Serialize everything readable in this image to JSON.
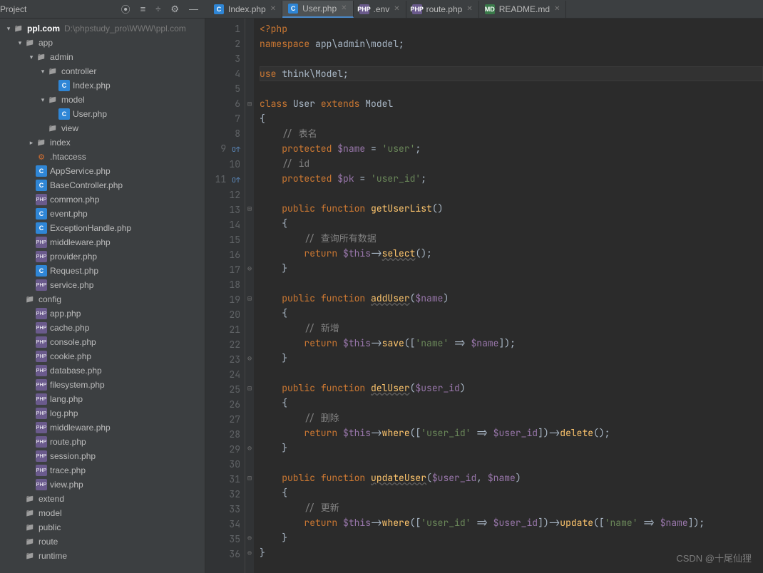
{
  "project_label": "Project",
  "toolbar_icons": [
    "target-icon",
    "collapse-icon",
    "refresh-icon",
    "gear-icon",
    "minimize-icon"
  ],
  "tabs": [
    {
      "icon": "ico-c",
      "label": "Index.php",
      "active": false
    },
    {
      "icon": "ico-c",
      "label": "User.php",
      "active": true
    },
    {
      "icon": "ico-php",
      "label": ".env",
      "active": false
    },
    {
      "icon": "ico-php",
      "label": "route.php",
      "active": false
    },
    {
      "icon": "ico-md",
      "label": "README.md",
      "active": false
    }
  ],
  "tree": [
    {
      "indent": 0,
      "chev": "▾",
      "icon": "folder",
      "label": "ppl.com",
      "bold": true,
      "path": "D:\\phpstudy_pro\\WWW\\ppl.com"
    },
    {
      "indent": 1,
      "chev": "▾",
      "icon": "folder",
      "label": "app"
    },
    {
      "indent": 2,
      "chev": "▾",
      "icon": "folder",
      "label": "admin"
    },
    {
      "indent": 3,
      "chev": "▾",
      "icon": "folder",
      "label": "controller"
    },
    {
      "indent": 4,
      "chev": "",
      "icon": "file-c",
      "label": "Index.php"
    },
    {
      "indent": 3,
      "chev": "▾",
      "icon": "folder",
      "label": "model"
    },
    {
      "indent": 4,
      "chev": "",
      "icon": "file-c",
      "label": "User.php"
    },
    {
      "indent": 3,
      "chev": "",
      "icon": "folder",
      "label": "view"
    },
    {
      "indent": 2,
      "chev": "▸",
      "icon": "folder",
      "label": "index"
    },
    {
      "indent": 2,
      "chev": "",
      "icon": "file-ht",
      "label": ".htaccess"
    },
    {
      "indent": 2,
      "chev": "",
      "icon": "file-c",
      "label": "AppService.php"
    },
    {
      "indent": 2,
      "chev": "",
      "icon": "file-c",
      "label": "BaseController.php"
    },
    {
      "indent": 2,
      "chev": "",
      "icon": "file-php",
      "label": "common.php"
    },
    {
      "indent": 2,
      "chev": "",
      "icon": "file-c",
      "label": "event.php"
    },
    {
      "indent": 2,
      "chev": "",
      "icon": "file-c",
      "label": "ExceptionHandle.php"
    },
    {
      "indent": 2,
      "chev": "",
      "icon": "file-php",
      "label": "middleware.php"
    },
    {
      "indent": 2,
      "chev": "",
      "icon": "file-php",
      "label": "provider.php"
    },
    {
      "indent": 2,
      "chev": "",
      "icon": "file-c",
      "label": "Request.php"
    },
    {
      "indent": 2,
      "chev": "",
      "icon": "file-php",
      "label": "service.php"
    },
    {
      "indent": 1,
      "chev": "",
      "icon": "folder",
      "label": "config"
    },
    {
      "indent": 2,
      "chev": "",
      "icon": "file-php",
      "label": "app.php"
    },
    {
      "indent": 2,
      "chev": "",
      "icon": "file-php",
      "label": "cache.php"
    },
    {
      "indent": 2,
      "chev": "",
      "icon": "file-php",
      "label": "console.php"
    },
    {
      "indent": 2,
      "chev": "",
      "icon": "file-php",
      "label": "cookie.php"
    },
    {
      "indent": 2,
      "chev": "",
      "icon": "file-php",
      "label": "database.php"
    },
    {
      "indent": 2,
      "chev": "",
      "icon": "file-php",
      "label": "filesystem.php"
    },
    {
      "indent": 2,
      "chev": "",
      "icon": "file-php",
      "label": "lang.php"
    },
    {
      "indent": 2,
      "chev": "",
      "icon": "file-php",
      "label": "log.php"
    },
    {
      "indent": 2,
      "chev": "",
      "icon": "file-php",
      "label": "middleware.php"
    },
    {
      "indent": 2,
      "chev": "",
      "icon": "file-php",
      "label": "route.php"
    },
    {
      "indent": 2,
      "chev": "",
      "icon": "file-php",
      "label": "session.php"
    },
    {
      "indent": 2,
      "chev": "",
      "icon": "file-php",
      "label": "trace.php"
    },
    {
      "indent": 2,
      "chev": "",
      "icon": "file-php",
      "label": "view.php"
    },
    {
      "indent": 1,
      "chev": "",
      "icon": "folder",
      "label": "extend"
    },
    {
      "indent": 1,
      "chev": "",
      "icon": "folder",
      "label": "model"
    },
    {
      "indent": 1,
      "chev": "",
      "icon": "folder",
      "label": "public"
    },
    {
      "indent": 1,
      "chev": "",
      "icon": "folder",
      "label": "route"
    },
    {
      "indent": 1,
      "chev": "",
      "icon": "folder",
      "label": "runtime"
    }
  ],
  "code": {
    "current_line": 4,
    "override_markers": [
      9,
      11
    ],
    "lines": [
      {
        "n": 1,
        "t": [
          [
            "kw",
            "<?php"
          ]
        ]
      },
      {
        "n": 2,
        "t": [
          [
            "kw",
            "namespace "
          ],
          [
            "cls",
            "app\\admin\\model"
          ],
          [
            "punct",
            ";"
          ]
        ]
      },
      {
        "n": 3,
        "t": []
      },
      {
        "n": 4,
        "hl": true,
        "t": [
          [
            "kw",
            "use "
          ],
          [
            "cls",
            "think\\Model"
          ],
          [
            "punct",
            ";"
          ]
        ]
      },
      {
        "n": 5,
        "t": []
      },
      {
        "n": 6,
        "fold": "⊟",
        "t": [
          [
            "kw",
            "class "
          ],
          [
            "cls",
            "User "
          ],
          [
            "kw",
            "extends "
          ],
          [
            "cls",
            "Model"
          ]
        ]
      },
      {
        "n": 7,
        "t": [
          [
            "punct",
            "{"
          ]
        ]
      },
      {
        "n": 8,
        "t": [
          [
            "",
            "    "
          ],
          [
            "cmt",
            "// 表名"
          ]
        ]
      },
      {
        "n": 9,
        "t": [
          [
            "",
            "    "
          ],
          [
            "kw",
            "protected "
          ],
          [
            "var",
            "$name"
          ],
          [
            "op",
            " = "
          ],
          [
            "str",
            "'user'"
          ],
          [
            "punct",
            ";"
          ]
        ]
      },
      {
        "n": 10,
        "t": [
          [
            "",
            "    "
          ],
          [
            "cmt",
            "// id"
          ]
        ]
      },
      {
        "n": 11,
        "t": [
          [
            "",
            "    "
          ],
          [
            "kw",
            "protected "
          ],
          [
            "var",
            "$pk"
          ],
          [
            "op",
            " = "
          ],
          [
            "str",
            "'user_id'"
          ],
          [
            "punct",
            ";"
          ]
        ]
      },
      {
        "n": 12,
        "t": []
      },
      {
        "n": 13,
        "fold": "⊟",
        "t": [
          [
            "",
            "    "
          ],
          [
            "kw",
            "public "
          ],
          [
            "kw",
            "function "
          ],
          [
            "fn",
            "getUserList"
          ],
          [
            "punct",
            "()"
          ]
        ]
      },
      {
        "n": 14,
        "t": [
          [
            "",
            "    "
          ],
          [
            "punct",
            "{"
          ]
        ]
      },
      {
        "n": 15,
        "t": [
          [
            "",
            "        "
          ],
          [
            "cmt",
            "// 查询所有数据"
          ]
        ]
      },
      {
        "n": 16,
        "t": [
          [
            "",
            "        "
          ],
          [
            "kw",
            "return "
          ],
          [
            "var",
            "$this"
          ],
          [
            "op",
            "->"
          ],
          [
            "fnu",
            "select"
          ],
          [
            "punct",
            "();"
          ]
        ]
      },
      {
        "n": 17,
        "fold": "⊖",
        "t": [
          [
            "",
            "    "
          ],
          [
            "punct",
            "}"
          ]
        ]
      },
      {
        "n": 18,
        "t": []
      },
      {
        "n": 19,
        "fold": "⊟",
        "t": [
          [
            "",
            "    "
          ],
          [
            "kw",
            "public "
          ],
          [
            "kw",
            "function "
          ],
          [
            "fnu",
            "addUser"
          ],
          [
            "punct",
            "("
          ],
          [
            "var",
            "$name"
          ],
          [
            "punct",
            ")"
          ]
        ]
      },
      {
        "n": 20,
        "t": [
          [
            "",
            "    "
          ],
          [
            "punct",
            "{"
          ]
        ]
      },
      {
        "n": 21,
        "t": [
          [
            "",
            "        "
          ],
          [
            "cmt",
            "// 新增"
          ]
        ]
      },
      {
        "n": 22,
        "t": [
          [
            "",
            "        "
          ],
          [
            "kw",
            "return "
          ],
          [
            "var",
            "$this"
          ],
          [
            "op",
            "->"
          ],
          [
            "fn",
            "save"
          ],
          [
            "punct",
            "(["
          ],
          [
            "str",
            "'name'"
          ],
          [
            "op",
            " => "
          ],
          [
            "var",
            "$name"
          ],
          [
            "punct",
            "]);"
          ]
        ]
      },
      {
        "n": 23,
        "fold": "⊖",
        "t": [
          [
            "",
            "    "
          ],
          [
            "punct",
            "}"
          ]
        ]
      },
      {
        "n": 24,
        "t": []
      },
      {
        "n": 25,
        "fold": "⊟",
        "t": [
          [
            "",
            "    "
          ],
          [
            "kw",
            "public "
          ],
          [
            "kw",
            "function "
          ],
          [
            "fnu",
            "delUser"
          ],
          [
            "punct",
            "("
          ],
          [
            "var",
            "$user_id"
          ],
          [
            "punct",
            ")"
          ]
        ]
      },
      {
        "n": 26,
        "t": [
          [
            "",
            "    "
          ],
          [
            "punct",
            "{"
          ]
        ]
      },
      {
        "n": 27,
        "t": [
          [
            "",
            "        "
          ],
          [
            "cmt",
            "// 删除"
          ]
        ]
      },
      {
        "n": 28,
        "t": [
          [
            "",
            "        "
          ],
          [
            "kw",
            "return "
          ],
          [
            "var",
            "$this"
          ],
          [
            "op",
            "->"
          ],
          [
            "fn",
            "where"
          ],
          [
            "punct",
            "(["
          ],
          [
            "str",
            "'user_id'"
          ],
          [
            "op",
            " => "
          ],
          [
            "var",
            "$user_id"
          ],
          [
            "punct",
            "])->"
          ],
          [
            "fn",
            "delete"
          ],
          [
            "punct",
            "();"
          ]
        ]
      },
      {
        "n": 29,
        "fold": "⊖",
        "t": [
          [
            "",
            "    "
          ],
          [
            "punct",
            "}"
          ]
        ]
      },
      {
        "n": 30,
        "t": []
      },
      {
        "n": 31,
        "fold": "⊟",
        "t": [
          [
            "",
            "    "
          ],
          [
            "kw",
            "public "
          ],
          [
            "kw",
            "function "
          ],
          [
            "fnu",
            "updateUser"
          ],
          [
            "punct",
            "("
          ],
          [
            "var",
            "$user_id"
          ],
          [
            "punct",
            ", "
          ],
          [
            "var",
            "$name"
          ],
          [
            "punct",
            ")"
          ]
        ]
      },
      {
        "n": 32,
        "t": [
          [
            "",
            "    "
          ],
          [
            "punct",
            "{"
          ]
        ]
      },
      {
        "n": 33,
        "t": [
          [
            "",
            "        "
          ],
          [
            "cmt",
            "// 更新"
          ]
        ]
      },
      {
        "n": 34,
        "t": [
          [
            "",
            "        "
          ],
          [
            "kw",
            "return "
          ],
          [
            "var",
            "$this"
          ],
          [
            "op",
            "->"
          ],
          [
            "fn",
            "where"
          ],
          [
            "punct",
            "(["
          ],
          [
            "str",
            "'user_id'"
          ],
          [
            "op",
            " => "
          ],
          [
            "var",
            "$user_id"
          ],
          [
            "punct",
            "])->"
          ],
          [
            "fn",
            "update"
          ],
          [
            "punct",
            "(["
          ],
          [
            "str",
            "'name'"
          ],
          [
            "op",
            " => "
          ],
          [
            "var",
            "$name"
          ],
          [
            "punct",
            "]);"
          ]
        ]
      },
      {
        "n": 35,
        "fold": "⊖",
        "t": [
          [
            "",
            "    "
          ],
          [
            "punct",
            "}"
          ]
        ]
      },
      {
        "n": 36,
        "fold": "⊖",
        "t": [
          [
            "punct",
            "}"
          ]
        ]
      }
    ]
  },
  "watermark": "CSDN @十尾仙狸"
}
